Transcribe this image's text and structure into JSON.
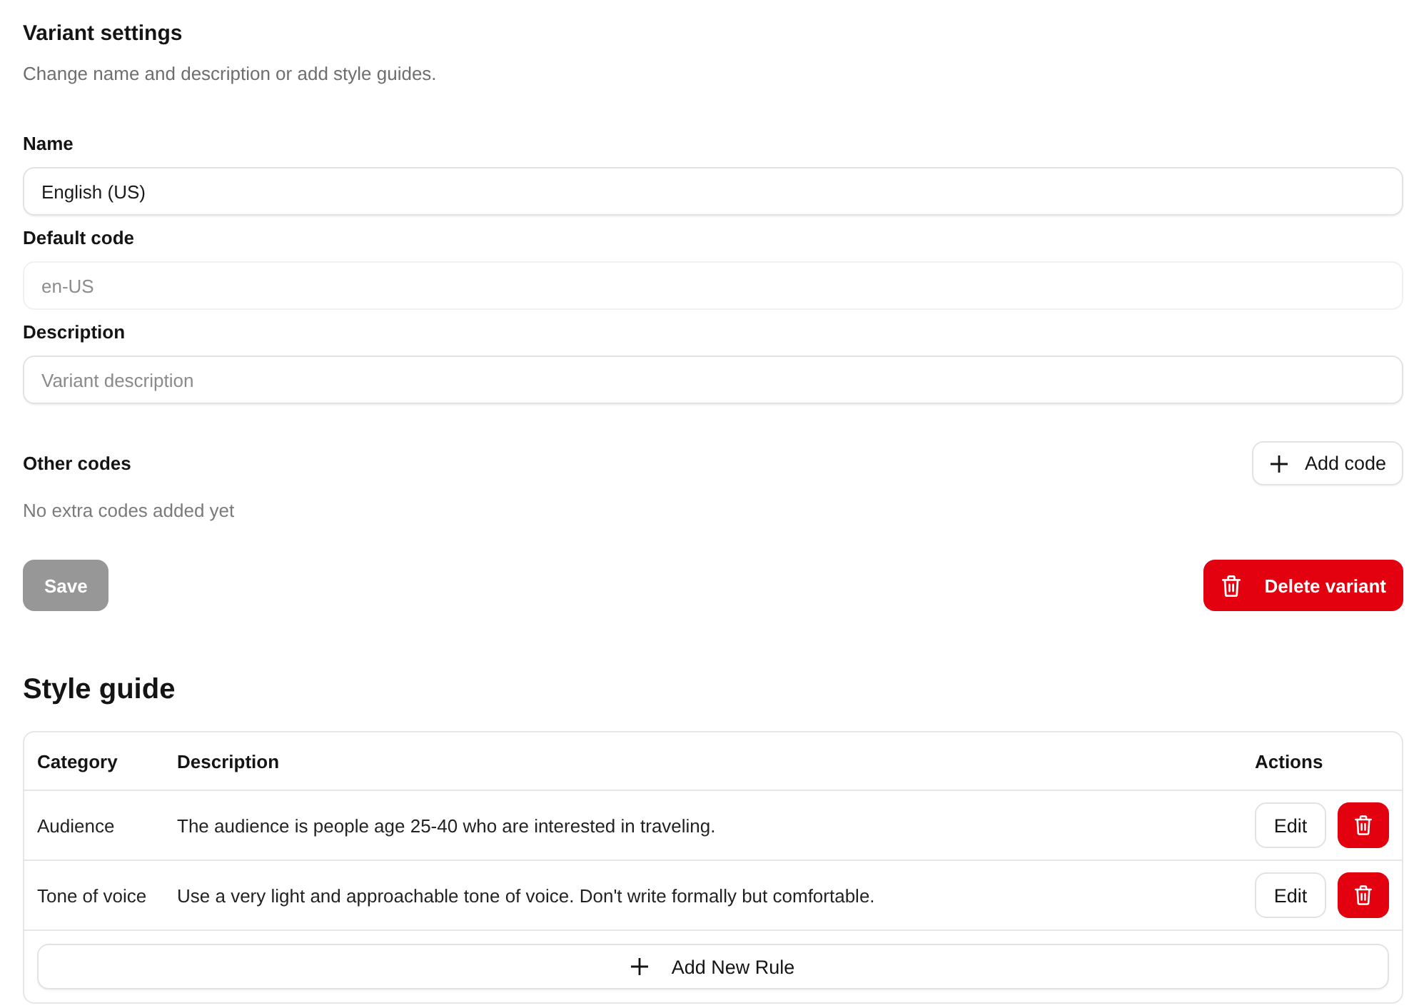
{
  "header": {
    "title": "Variant settings",
    "subtitle": "Change name and description or add style guides."
  },
  "fields": [
    {
      "label": "Name",
      "value": "English (US)",
      "disabled": false
    },
    {
      "label": "Default code",
      "value": "en-US",
      "disabled": true
    },
    {
      "label": "Description",
      "placeholder": "Variant description",
      "disabled": false
    }
  ],
  "other_codes": {
    "label": "Other codes",
    "add_button": "Add code",
    "empty_text": "No extra codes added yet"
  },
  "actions": {
    "save": {
      "label": "Save",
      "disabled": true
    },
    "delete": {
      "label": "Delete variant"
    }
  },
  "style_guide": {
    "title": "Style guide",
    "columns": [
      "Category",
      "Description",
      "Actions"
    ],
    "rows": [
      {
        "category": "Audience",
        "description": "The audience is people age 25-40 who are interested in traveling.",
        "edit": "Edit"
      },
      {
        "category": "Tone of voice",
        "description": "Use a very light and approachable tone of voice. Don't write formally but comfortable.",
        "edit": "Edit"
      }
    ],
    "add_button": "Add New Rule"
  }
}
